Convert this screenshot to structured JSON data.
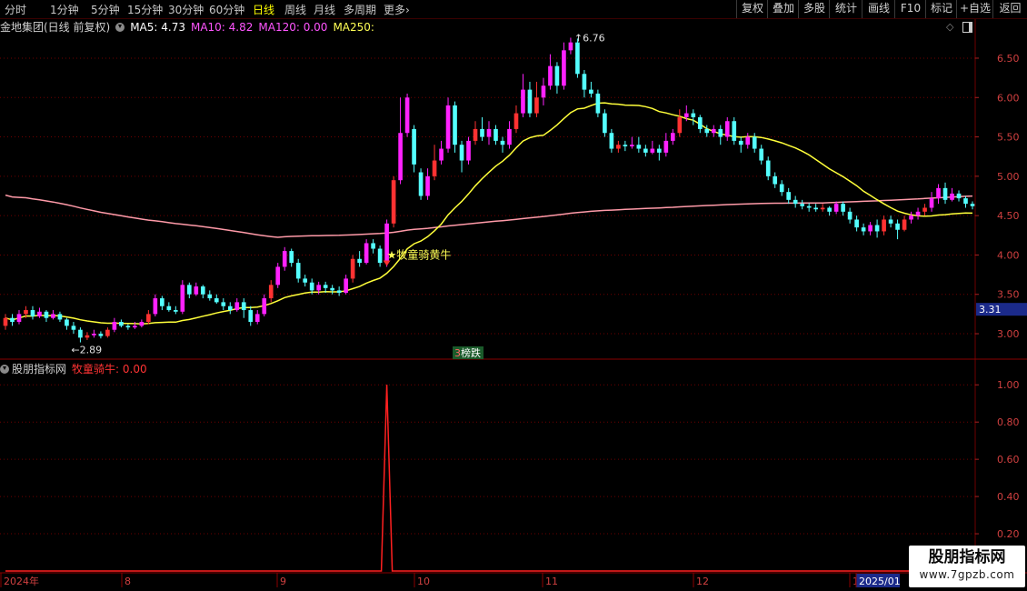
{
  "toolbar": {
    "periods": [
      "分时",
      "1分钟",
      "5分钟",
      "15分钟",
      "30分钟",
      "60分钟",
      "日线",
      "周线",
      "月线",
      "多周期",
      "更多"
    ],
    "more_arrow": "›",
    "active": "日线",
    "right_buttons": [
      "复权",
      "叠加",
      "多股",
      "统计",
      "画线",
      "F10",
      "标记",
      "+自选",
      "返回"
    ]
  },
  "header": {
    "stock": "金地集团(日线 前复权)",
    "ma5_label": "MA5: 4.73",
    "ma10_label": "MA10: 4.82",
    "ma120_label": "MA120: 0.00",
    "ma250_label": "MA250:",
    "ma5_color": "#ffffff",
    "ma10_color": "#ff55ff",
    "ma120_color": "#ff55ff",
    "ma250_color": "#ffff55"
  },
  "price_axis": {
    "ticks": [
      "6.50",
      "6.00",
      "5.50",
      "5.00",
      "4.50",
      "4.00",
      "3.50",
      "3.00"
    ],
    "current_price": "3.31"
  },
  "annotations": {
    "high": "6.76",
    "low": "2.89",
    "signal": "★牧童骑黄牛",
    "tag_num": "3",
    "tag_text": "榜跌"
  },
  "indicator": {
    "title": "股朋指标网",
    "name_value": "牧童骑牛: 0.00",
    "ticks": [
      "1.00",
      "0.80",
      "0.60",
      "0.40",
      "0.20"
    ]
  },
  "date_axis": {
    "labels": [
      "2024年",
      "8",
      "9",
      "10",
      "11",
      "12",
      "1",
      "2025/01"
    ]
  },
  "watermark": {
    "line1": "股朋指标网",
    "line2": "www.7gpzb.com"
  },
  "colors": {
    "up": "#ff3232",
    "up_hollow": "#ff22ff",
    "down": "#54ffff",
    "ma_yellow": "#ffff3a",
    "ma_pink": "#ff9aa8",
    "grid": "#6e0000"
  },
  "chart_data": {
    "type": "candlestick",
    "price_range": [
      2.7,
      6.8
    ],
    "indicator_range": [
      0,
      1.05
    ],
    "signal_value": 1.0,
    "candles": [
      [
        3.1,
        3.2,
        3.25,
        3.05
      ],
      [
        3.2,
        3.15,
        3.25,
        3.1
      ],
      [
        3.15,
        3.25,
        3.3,
        3.12
      ],
      [
        3.25,
        3.3,
        3.35,
        3.2
      ],
      [
        3.3,
        3.22,
        3.35,
        3.18
      ],
      [
        3.22,
        3.28,
        3.33,
        3.2
      ],
      [
        3.28,
        3.2,
        3.3,
        3.15
      ],
      [
        3.2,
        3.25,
        3.3,
        3.18
      ],
      [
        3.25,
        3.18,
        3.28,
        3.15
      ],
      [
        3.18,
        3.1,
        3.2,
        3.05
      ],
      [
        3.1,
        3.05,
        3.15,
        3.0
      ],
      [
        3.05,
        2.95,
        3.08,
        2.89
      ],
      [
        2.95,
        2.98,
        3.02,
        2.92
      ],
      [
        2.98,
        3.0,
        3.05,
        2.95
      ],
      [
        3.0,
        2.97,
        3.03,
        2.94
      ],
      [
        2.97,
        3.05,
        3.08,
        2.95
      ],
      [
        3.05,
        3.15,
        3.2,
        3.02
      ],
      [
        3.15,
        3.1,
        3.18,
        3.08
      ],
      [
        3.1,
        3.08,
        3.12,
        3.05
      ],
      [
        3.08,
        3.1,
        3.15,
        3.06
      ],
      [
        3.1,
        3.15,
        3.18,
        3.08
      ],
      [
        3.15,
        3.25,
        3.3,
        3.12
      ],
      [
        3.25,
        3.45,
        3.5,
        3.22
      ],
      [
        3.45,
        3.35,
        3.48,
        3.3
      ],
      [
        3.35,
        3.3,
        3.4,
        3.28
      ],
      [
        3.3,
        3.28,
        3.35,
        3.25
      ],
      [
        3.28,
        3.62,
        3.68,
        3.25
      ],
      [
        3.62,
        3.5,
        3.65,
        3.45
      ],
      [
        3.5,
        3.6,
        3.65,
        3.48
      ],
      [
        3.6,
        3.5,
        3.62,
        3.45
      ],
      [
        3.5,
        3.45,
        3.55,
        3.42
      ],
      [
        3.45,
        3.4,
        3.5,
        3.38
      ],
      [
        3.4,
        3.35,
        3.45,
        3.3
      ],
      [
        3.35,
        3.3,
        3.4,
        3.25
      ],
      [
        3.3,
        3.4,
        3.45,
        3.28
      ],
      [
        3.4,
        3.3,
        3.45,
        3.2
      ],
      [
        3.3,
        3.15,
        3.35,
        3.1
      ],
      [
        3.15,
        3.25,
        3.3,
        3.12
      ],
      [
        3.25,
        3.45,
        3.5,
        3.22
      ],
      [
        3.45,
        3.62,
        3.68,
        3.4
      ],
      [
        3.62,
        3.85,
        3.9,
        3.58
      ],
      [
        3.85,
        4.05,
        4.1,
        3.8
      ],
      [
        4.05,
        3.9,
        4.08,
        3.85
      ],
      [
        3.9,
        3.7,
        3.95,
        3.65
      ],
      [
        3.7,
        3.65,
        3.75,
        3.6
      ],
      [
        3.65,
        3.55,
        3.7,
        3.5
      ],
      [
        3.55,
        3.62,
        3.66,
        3.5
      ],
      [
        3.62,
        3.58,
        3.66,
        3.52
      ],
      [
        3.58,
        3.55,
        3.62,
        3.5
      ],
      [
        3.55,
        3.52,
        3.6,
        3.48
      ],
      [
        3.52,
        3.7,
        3.75,
        3.5
      ],
      [
        3.7,
        3.95,
        4.0,
        3.65
      ],
      [
        3.95,
        3.9,
        4.05,
        3.85
      ],
      [
        3.9,
        4.15,
        4.2,
        3.88
      ],
      [
        4.15,
        4.08,
        4.2,
        4.02
      ],
      [
        4.08,
        3.9,
        4.12,
        3.85
      ],
      [
        3.9,
        4.4,
        4.45,
        3.85
      ],
      [
        4.4,
        4.95,
        5.0,
        4.35
      ],
      [
        4.95,
        5.55,
        6.0,
        4.9
      ],
      [
        5.55,
        6.0,
        6.05,
        5.5
      ],
      [
        5.6,
        5.15,
        5.65,
        5.05
      ],
      [
        5.05,
        4.75,
        5.1,
        4.7
      ],
      [
        4.75,
        5.0,
        5.1,
        4.7
      ],
      [
        5.0,
        5.2,
        5.4,
        4.95
      ],
      [
        5.2,
        5.35,
        5.45,
        5.15
      ],
      [
        5.35,
        5.9,
        6.0,
        5.3
      ],
      [
        5.9,
        5.4,
        5.95,
        5.3
      ],
      [
        5.4,
        5.2,
        5.45,
        5.05
      ],
      [
        5.2,
        5.45,
        5.5,
        5.15
      ],
      [
        5.45,
        5.6,
        5.7,
        5.4
      ],
      [
        5.6,
        5.5,
        5.75,
        5.45
      ],
      [
        5.5,
        5.6,
        5.7,
        5.4
      ],
      [
        5.6,
        5.45,
        5.65,
        5.4
      ],
      [
        5.45,
        5.4,
        5.5,
        5.3
      ],
      [
        5.4,
        5.6,
        5.7,
        5.35
      ],
      [
        5.6,
        5.8,
        5.9,
        5.55
      ],
      [
        5.8,
        6.1,
        6.3,
        5.75
      ],
      [
        6.1,
        5.8,
        6.2,
        5.75
      ],
      [
        5.8,
        6.0,
        6.2,
        5.75
      ],
      [
        6.0,
        6.15,
        6.25,
        5.9
      ],
      [
        6.15,
        6.4,
        6.55,
        6.1
      ],
      [
        6.4,
        6.15,
        6.45,
        6.05
      ],
      [
        6.15,
        6.6,
        6.7,
        6.1
      ],
      [
        6.6,
        6.7,
        6.76,
        6.55
      ],
      [
        6.7,
        6.3,
        6.75,
        6.25
      ],
      [
        6.3,
        6.1,
        6.35,
        6.0
      ],
      [
        6.1,
        6.05,
        6.2,
        6.0
      ],
      [
        6.05,
        5.8,
        6.1,
        5.75
      ],
      [
        5.8,
        5.55,
        5.85,
        5.5
      ],
      [
        5.55,
        5.35,
        5.6,
        5.3
      ],
      [
        5.35,
        5.4,
        5.45,
        5.3
      ],
      [
        5.4,
        5.38,
        5.45,
        5.32
      ],
      [
        5.38,
        5.4,
        5.5,
        5.35
      ],
      [
        5.4,
        5.35,
        5.5,
        5.3
      ],
      [
        5.35,
        5.3,
        5.4,
        5.25
      ],
      [
        5.3,
        5.35,
        5.45,
        5.28
      ],
      [
        5.35,
        5.3,
        5.4,
        5.2
      ],
      [
        5.3,
        5.45,
        5.55,
        5.25
      ],
      [
        5.45,
        5.55,
        5.6,
        5.4
      ],
      [
        5.55,
        5.75,
        5.85,
        5.5
      ],
      [
        5.75,
        5.8,
        5.9,
        5.7
      ],
      [
        5.8,
        5.75,
        5.85,
        5.65
      ],
      [
        5.75,
        5.6,
        5.78,
        5.55
      ],
      [
        5.6,
        5.55,
        5.65,
        5.5
      ],
      [
        5.55,
        5.6,
        5.65,
        5.5
      ],
      [
        5.6,
        5.5,
        5.65,
        5.4
      ],
      [
        5.5,
        5.7,
        5.75,
        5.45
      ],
      [
        5.7,
        5.45,
        5.75,
        5.4
      ],
      [
        5.45,
        5.4,
        5.5,
        5.3
      ],
      [
        5.4,
        5.5,
        5.55,
        5.35
      ],
      [
        5.5,
        5.35,
        5.55,
        5.3
      ],
      [
        5.35,
        5.2,
        5.4,
        5.15
      ],
      [
        5.2,
        5.0,
        5.25,
        4.95
      ],
      [
        5.0,
        4.9,
        5.05,
        4.85
      ],
      [
        4.9,
        4.8,
        4.95,
        4.75
      ],
      [
        4.8,
        4.7,
        4.85,
        4.65
      ],
      [
        4.7,
        4.65,
        4.75,
        4.6
      ],
      [
        4.65,
        4.62,
        4.7,
        4.58
      ],
      [
        4.62,
        4.6,
        4.66,
        4.55
      ],
      [
        4.6,
        4.58,
        4.65,
        4.55
      ],
      [
        4.58,
        4.6,
        4.65,
        4.55
      ],
      [
        4.6,
        4.55,
        4.62,
        4.5
      ],
      [
        4.55,
        4.65,
        4.68,
        4.52
      ],
      [
        4.65,
        4.55,
        4.68,
        4.5
      ],
      [
        4.55,
        4.45,
        4.6,
        4.4
      ],
      [
        4.45,
        4.35,
        4.5,
        4.3
      ],
      [
        4.35,
        4.3,
        4.4,
        4.25
      ],
      [
        4.3,
        4.38,
        4.42,
        4.25
      ],
      [
        4.38,
        4.3,
        4.45,
        4.22
      ],
      [
        4.3,
        4.45,
        4.5,
        4.25
      ],
      [
        4.45,
        4.4,
        4.5,
        4.35
      ],
      [
        4.4,
        4.32,
        4.45,
        4.2
      ],
      [
        4.32,
        4.45,
        4.5,
        4.3
      ],
      [
        4.45,
        4.5,
        4.55,
        4.4
      ],
      [
        4.5,
        4.55,
        4.6,
        4.45
      ],
      [
        4.55,
        4.6,
        4.65,
        4.5
      ],
      [
        4.6,
        4.72,
        4.8,
        4.55
      ],
      [
        4.72,
        4.85,
        4.9,
        4.65
      ],
      [
        4.85,
        4.7,
        4.92,
        4.65
      ],
      [
        4.7,
        4.78,
        4.85,
        4.68
      ],
      [
        4.78,
        4.72,
        4.82,
        4.68
      ],
      [
        4.72,
        4.65,
        4.75,
        4.6
      ],
      [
        4.65,
        4.62,
        4.68,
        4.58
      ]
    ]
  }
}
